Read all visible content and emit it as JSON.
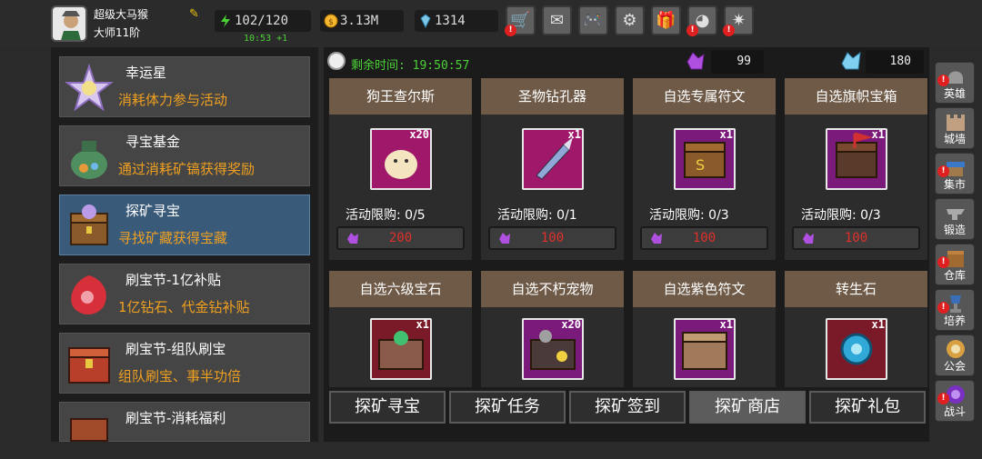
{
  "player": {
    "name": "超级大马猴",
    "rank": "大师11阶",
    "stamina": "102/120",
    "stamina_timer": "10:53 +1",
    "gold": "3.13M",
    "diamond": "1314"
  },
  "top_buttons": [
    "shop-cart",
    "mail",
    "gamepad",
    "settings",
    "gift",
    "color-wheel",
    "fireworks"
  ],
  "events": [
    {
      "title": "幸运星",
      "desc": "消耗体力参与活动"
    },
    {
      "title": "寻宝基金",
      "desc": "通过消耗矿镐获得奖励"
    },
    {
      "title": "探矿寻宝",
      "desc": "寻找矿藏获得宝藏"
    },
    {
      "title": "刷宝节-1亿补贴",
      "desc": "1亿钻石、代金钻补贴"
    },
    {
      "title": "刷宝节-组队刷宝",
      "desc": "组队刷宝、事半功倍"
    },
    {
      "title": "刷宝节-消耗福利",
      "desc": ""
    }
  ],
  "shop": {
    "countdown": "剩余时间: 19:50:57",
    "purple_crystal": "99",
    "blue_crystal": "180",
    "items": [
      {
        "name": "狗王查尔斯",
        "qty": "x20",
        "limit": "活动限购: 0/5",
        "price": "200"
      },
      {
        "name": "圣物钻孔器",
        "qty": "x1",
        "limit": "活动限购: 0/1",
        "price": "100"
      },
      {
        "name": "自选专属符文",
        "qty": "x1",
        "limit": "活动限购: 0/3",
        "price": "100"
      },
      {
        "name": "自选旗帜宝箱",
        "qty": "x1",
        "limit": "活动限购: 0/3",
        "price": "100"
      },
      {
        "name": "自选六级宝石",
        "qty": "x1",
        "limit": "",
        "price": ""
      },
      {
        "name": "自选不朽宠物",
        "qty": "x20",
        "limit": "",
        "price": ""
      },
      {
        "name": "自选紫色符文",
        "qty": "x1",
        "limit": "",
        "price": ""
      },
      {
        "name": "转生石",
        "qty": "x1",
        "limit": "",
        "price": ""
      }
    ]
  },
  "tabs": [
    "探矿寻宝",
    "探矿任务",
    "探矿签到",
    "探矿商店",
    "探矿礼包"
  ],
  "sidebar": [
    "英雄",
    "城墙",
    "集市",
    "锻造",
    "仓库",
    "培养",
    "公会",
    "战斗"
  ],
  "colors": {
    "accent_green": "#4cd137",
    "orange_text": "#f0a020",
    "price_red": "#e0302a",
    "card_header": "#6e5a47"
  }
}
